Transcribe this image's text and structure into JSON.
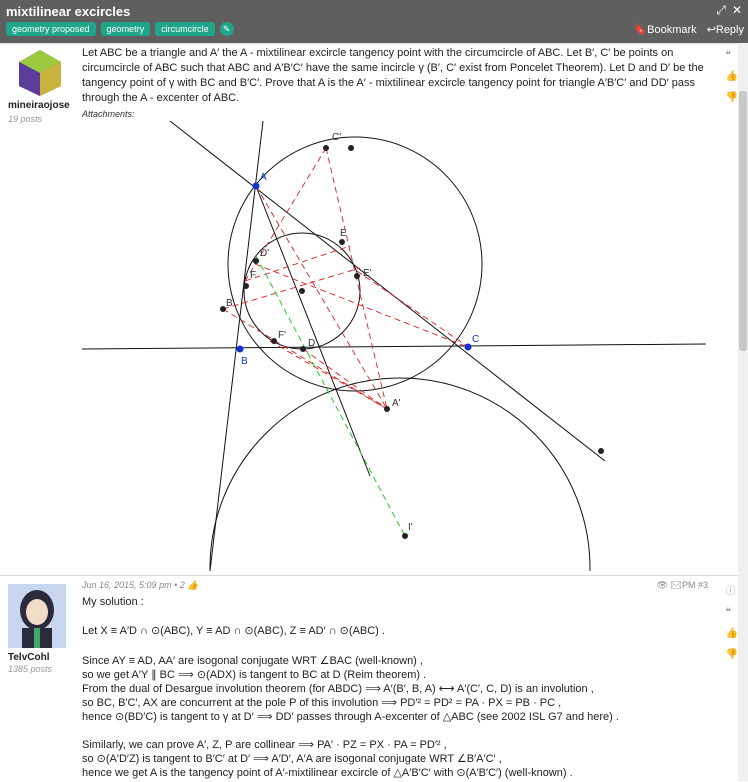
{
  "topic": {
    "title": "mixtilinear excircles",
    "tags": [
      "geometry proposed",
      "geometry",
      "circumcircle"
    ],
    "bookmark": "Bookmark",
    "reply": "Reply"
  },
  "post1": {
    "user": "mineiraojose",
    "posts": "19 posts",
    "text": "Let ABC be a triangle and A′ the A - mixtilinear excircle tangency point with the circumcircle of ABC. Let B′, C′ be points on circumcircle of ABC such that ABC and A′B′C′ have the same incircle γ (B′, C′ exist from Poncelet Theorem). Let D and D′ be the tangency point of γ with BC and B′C′. Prove that A is the A′ - mixtilinear excircle tangency point for triangle A′B′C′ and DD′ pass through the A - excenter of ABC.",
    "attachments": "Attachments:",
    "diagram_labels": [
      "A",
      "B",
      "C",
      "C'",
      "E",
      "E'",
      "D'",
      "F",
      "B'",
      "F'",
      "D",
      "A'",
      "I'"
    ]
  },
  "post2": {
    "user": "TelvCohl",
    "posts": "1385 posts",
    "meta": "Jun 16, 2015, 5:09 pm • 2 👍",
    "pm": "PM #3",
    "title": "My solution :",
    "lines": [
      "Let X ≡ A′D ∩ ⊙(ABC), Y ≡ AD ∩ ⊙(ABC), Z ≡ AD′ ∩ ⊙(ABC) .",
      "Since AY ≡ AD, AA′ are isogonal conjugate WRT ∠BAC (well-known) ,",
      "so we get A′Y ∥ BC ⟹ ⊙(ADX) is tangent to BC at D (Reim theorem) .",
      "From the dual of Desargue involution theorem (for ABDC) ⟹ A′(B′, B, A) ⟷ A′(C′, C, D) is an involution ,",
      "so BC, B′C′, AX are concurrent at the pole P of this involution ⟹ PD′² = PD² = PA · PX = PB · PC ,",
      "hence ⊙(BD′C) is tangent to γ at D′ ⟹ DD′ passes through A-excenter of △ABC (see 2002 ISL G7 and here) .",
      "Similarly, we can prove A′, Z, P are collinear ⟹ PA′ · PZ = PX · PA = PD′² ,",
      "so ⊙(A′D′Z) is tangent to B′C′ at D′ ⟹ A′D′, A′A are isogonal conjugate WRT ∠B′A′C′ ,",
      "hence we get A is the tangency point of A′-mixtilinear excircle of △A′B′C′ with ⊙(A′B′C′) (well-known) ."
    ]
  }
}
